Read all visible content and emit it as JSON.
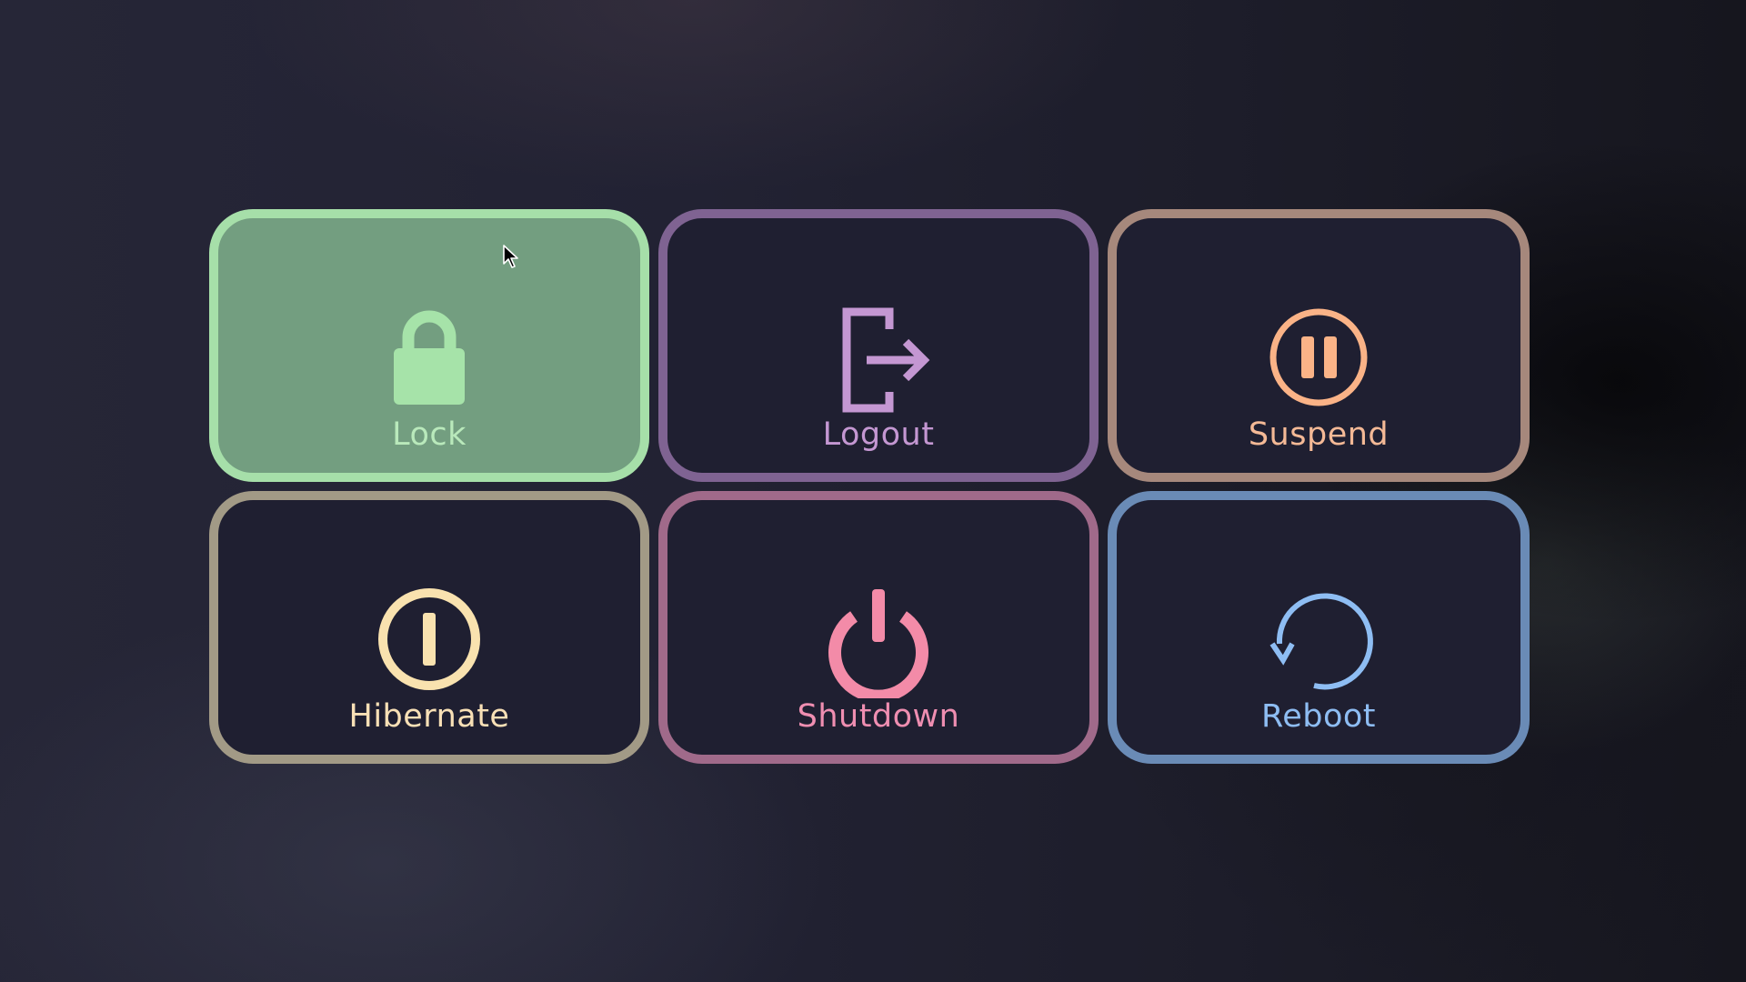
{
  "menu": {
    "items": [
      {
        "id": "lock",
        "label": "Lock",
        "icon": "lock-icon",
        "color": "#a6e3a1",
        "selected": true
      },
      {
        "id": "logout",
        "label": "Logout",
        "icon": "logout-icon",
        "color": "#c497d2",
        "selected": false
      },
      {
        "id": "suspend",
        "label": "Suspend",
        "icon": "pause-icon",
        "color": "#fab387",
        "selected": false
      },
      {
        "id": "hibernate",
        "label": "Hibernate",
        "icon": "hibernate-icon",
        "color": "#f9e2af",
        "selected": false
      },
      {
        "id": "shutdown",
        "label": "Shutdown",
        "icon": "power-icon",
        "color": "#f38ba8",
        "selected": false
      },
      {
        "id": "reboot",
        "label": "Reboot",
        "icon": "reboot-icon",
        "color": "#89b4fa",
        "selected": false
      }
    ]
  }
}
